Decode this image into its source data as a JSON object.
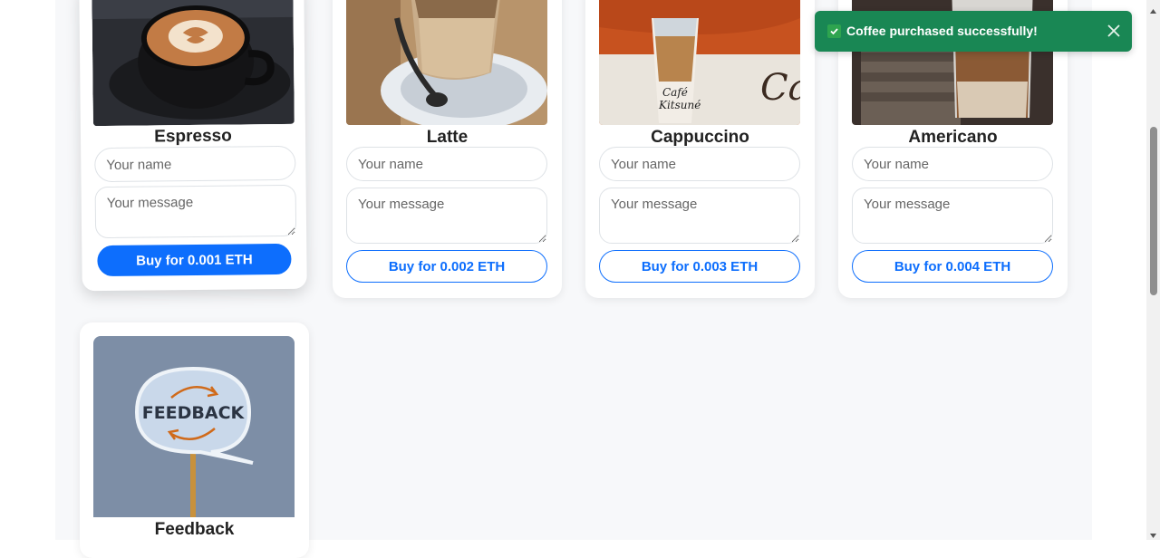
{
  "products": [
    {
      "title": "Espresso",
      "name_placeholder": "Your name",
      "message_placeholder": "Your message",
      "button_label": "Buy for 0.001 ETH"
    },
    {
      "title": "Latte",
      "name_placeholder": "Your name",
      "message_placeholder": "Your message",
      "button_label": "Buy for 0.002 ETH"
    },
    {
      "title": "Cappuccino",
      "name_placeholder": "Your name",
      "message_placeholder": "Your message",
      "button_label": "Buy for 0.003 ETH"
    },
    {
      "title": "Americano",
      "name_placeholder": "Your name",
      "message_placeholder": "Your message",
      "button_label": "Buy for 0.004 ETH"
    }
  ],
  "feedback": {
    "title": "Feedback",
    "image_text": "FEEDBACK"
  },
  "toast": {
    "message": "Coffee purchased successfully!",
    "close_icon": "close-icon",
    "check_icon": "check-icon",
    "color": "#198754"
  },
  "colors": {
    "primary": "#0d6efd",
    "success": "#198754"
  }
}
